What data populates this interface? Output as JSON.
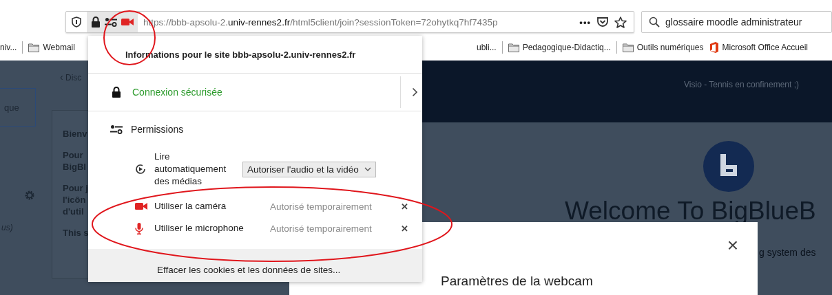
{
  "toolbar": {
    "url": {
      "prefix": "https://bbb-apsolu-2.",
      "domain": "univ-rennes2.fr",
      "path": "/html5client/join?sessionToken=72ohytkq7hf7435p"
    },
    "more": "•••",
    "search": {
      "value": "glossaire moodle administrateur"
    }
  },
  "bookmarks": {
    "left": [
      {
        "kind": "plain",
        "label": "niv..."
      },
      {
        "kind": "folder",
        "label": "Webmail"
      }
    ],
    "right": [
      {
        "kind": "plain",
        "label": "ubli..."
      },
      {
        "kind": "folder",
        "label": "Pedagogique-Didactiq..."
      },
      {
        "kind": "folder",
        "label": "Outils numériques"
      },
      {
        "kind": "office",
        "label": "Microsoft Office Accueil"
      }
    ]
  },
  "page": {
    "sidebar": {
      "button": "que",
      "note": "us)"
    },
    "back_icon": "‹",
    "back_link": "Disc",
    "card_lines": [
      [
        "Bienv"
      ],
      [
        "Pour",
        "BigBl"
      ],
      [
        "Pour j",
        "l'icôn",
        "d'util"
      ],
      [
        "This s"
      ]
    ],
    "header_title": "Visio - Tennis en confinement ;)",
    "welcome": "Welcome To BigBlueB",
    "subtitle": "g system des"
  },
  "site_info": {
    "title": "Informations pour le site bbb-apsolu-2.univ-rennes2.fr",
    "connection": "Connexion sécurisée",
    "permissions_heading": "Permissions",
    "permissions": [
      {
        "kind": "autoplay",
        "label": "Lire automatiquement des médias",
        "value": "Autoriser l'audio et la vidéo"
      },
      {
        "kind": "camera",
        "label": "Utiliser la caméra",
        "status": "Autorisé temporairement",
        "remove": "✕"
      },
      {
        "kind": "microphone",
        "label": "Utiliser le microphone",
        "status": "Autorisé temporairement",
        "remove": "✕"
      }
    ],
    "clear_link": "Effacer les cookies et les données de sites..."
  },
  "webcam_dialog": {
    "close": "×",
    "title": "Paramètres de la webcam"
  }
}
